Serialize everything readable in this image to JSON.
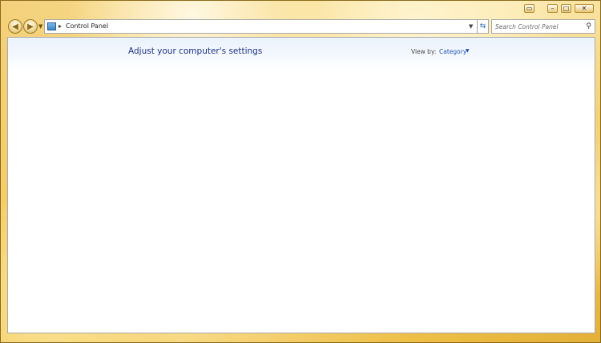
{
  "window": {
    "address": {
      "breadcrumb": "Control Panel",
      "search_placeholder": "Search Control Panel"
    },
    "icons": {
      "back": "back-arrow-icon",
      "forward": "forward-arrow-icon",
      "control_panel": "control-panel-icon",
      "refresh": "refresh-icon",
      "search": "search-icon",
      "minimize": "minimize-icon",
      "maximize": "maximize-icon",
      "close": "close-icon"
    }
  },
  "content": {
    "title": "Adjust your computer's settings",
    "view_by_label": "View by:",
    "view_by_value": "Category"
  },
  "colors": {
    "title": "#1e3287",
    "link": "#1e56b3",
    "frame_accent": "#e8b12a"
  }
}
